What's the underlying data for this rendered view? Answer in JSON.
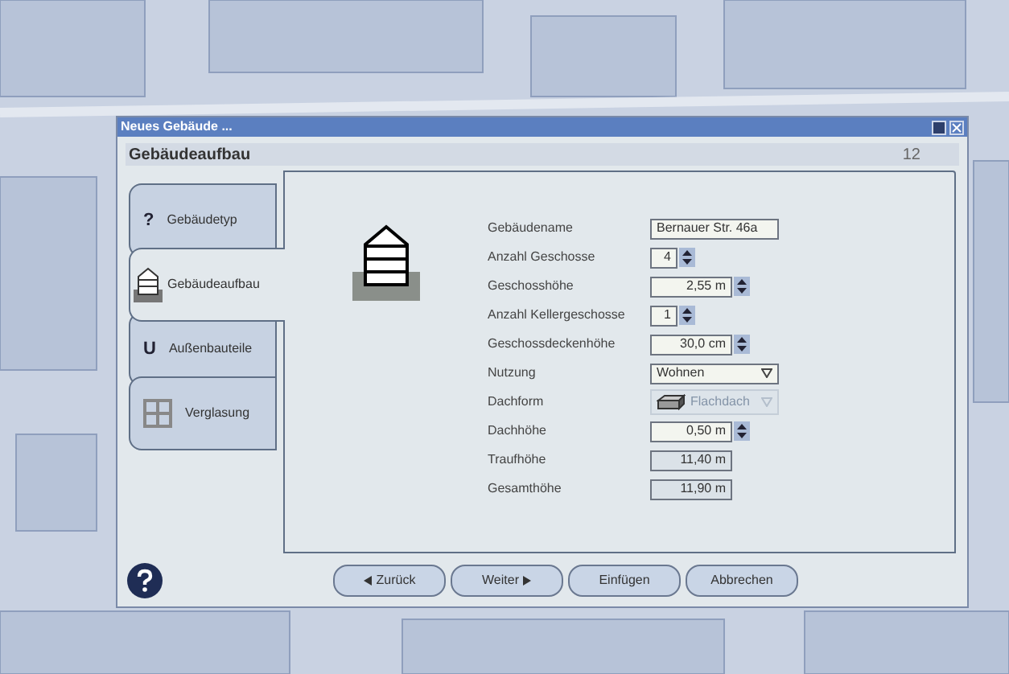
{
  "window": {
    "title": "Neues Gebäude ..."
  },
  "header": {
    "title": "Gebäudeaufbau",
    "page": "12"
  },
  "tabs": [
    {
      "label": "Gebäudetyp",
      "kind": "glyph",
      "glyph": "?",
      "selected": false
    },
    {
      "label": "Gebäudeaufbau",
      "kind": "building",
      "selected": true
    },
    {
      "label": "Außenbauteile",
      "kind": "glyph",
      "glyph": "U",
      "selected": false
    },
    {
      "label": "Verglasung",
      "kind": "window",
      "selected": false
    }
  ],
  "fields": [
    {
      "label": "Gebäudename",
      "kind": "text",
      "value": "Bernauer Str. 46a"
    },
    {
      "label": "Anzahl Geschosse",
      "kind": "count",
      "value": "4"
    },
    {
      "label": "Geschosshöhe",
      "kind": "measure",
      "value": "2,55 m"
    },
    {
      "label": "Anzahl Kellergeschosse",
      "kind": "count",
      "value": "1"
    },
    {
      "label": "Geschossdeckenhöhe",
      "kind": "measure",
      "value": "30,0 cm"
    },
    {
      "label": "Nutzung",
      "kind": "select",
      "value": "Wohnen",
      "disabled": false
    },
    {
      "label": "Dachform",
      "kind": "select",
      "value": "Flachdach",
      "disabled": true
    },
    {
      "label": "Dachhöhe",
      "kind": "measure",
      "value": "0,50 m"
    },
    {
      "label": "Traufhöhe",
      "kind": "readonly",
      "value": "11,40 m"
    },
    {
      "label": "Gesamthöhe",
      "kind": "readonly",
      "value": "11,90 m"
    }
  ],
  "buttons": [
    {
      "label": "Zurück",
      "kind": "back"
    },
    {
      "label": "Weiter",
      "kind": "next"
    },
    {
      "label": "Einfügen",
      "kind": "plain"
    },
    {
      "label": "Abbrechen",
      "kind": "plain"
    }
  ]
}
